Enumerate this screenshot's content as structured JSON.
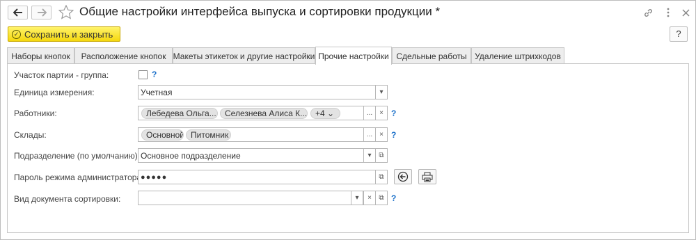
{
  "window": {
    "title": "Общие настройки интерфейса выпуска и сортировки продукции *"
  },
  "toolbar": {
    "save_label": "Сохранить и закрыть",
    "help_label": "?"
  },
  "tabs": [
    {
      "label": "Наборы кнопок"
    },
    {
      "label": "Расположение кнопок"
    },
    {
      "label": "Макеты этикеток и другие настройки"
    },
    {
      "label": "Прочие настройки",
      "active": true
    },
    {
      "label": "Сдельные работы"
    },
    {
      "label": "Удаление штрихкодов"
    }
  ],
  "form": {
    "batch_group": {
      "label": "Участок партии - группа:",
      "checked": false,
      "help": "?"
    },
    "unit": {
      "label": "Единица измерения:",
      "value": "Учетная"
    },
    "workers": {
      "label": "Работники:",
      "chips": [
        "Лебедева Ольга...",
        "Селезнева Алиса К..."
      ],
      "more": "+4",
      "help": "?"
    },
    "warehouses": {
      "label": "Склады:",
      "chips": [
        "Основной",
        "Питомник"
      ],
      "help": "?"
    },
    "department": {
      "label": "Подразделение (по умолчанию):",
      "value": "Основное подразделение"
    },
    "admin_password": {
      "label": "Пароль режима администратора:",
      "value": "●●●●●"
    },
    "sort_doc_type": {
      "label": "Вид документа сортировки:",
      "value": "",
      "help": "?"
    }
  },
  "icons": {
    "dots": "...",
    "clear": "×",
    "dropdown": "▾",
    "open": "⧉"
  }
}
